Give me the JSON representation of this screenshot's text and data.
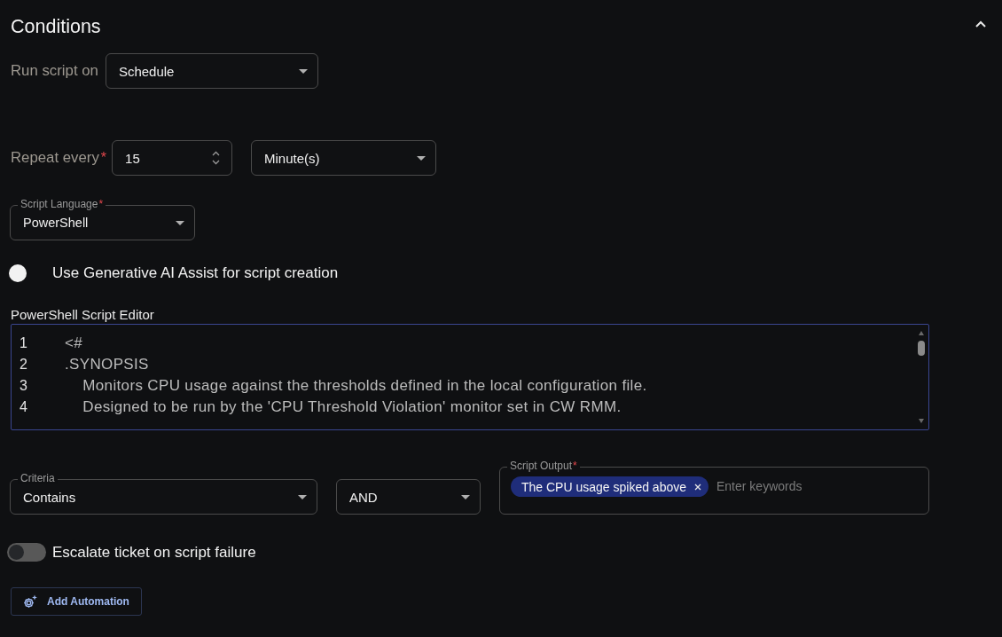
{
  "section": {
    "title": "Conditions",
    "expanded": true
  },
  "run_script_on": {
    "label": "Run script on",
    "value": "Schedule"
  },
  "repeat": {
    "label": "Repeat every",
    "required_mark": "*",
    "interval": "15",
    "unit": "Minute(s)"
  },
  "script_language": {
    "label": "Script Language",
    "required_mark": "*",
    "value": "PowerShell"
  },
  "ai_assist": {
    "label": "Use Generative AI Assist for script creation",
    "on": false
  },
  "editor": {
    "label": "PowerShell Script Editor",
    "lines": [
      {
        "number": "1",
        "code": "<#"
      },
      {
        "number": "2",
        "code": ".SYNOPSIS"
      },
      {
        "number": "3",
        "code": "    Monitors CPU usage against the thresholds defined in the local configuration file."
      },
      {
        "number": "4",
        "code": "    Designed to be run by the 'CPU Threshold Violation' monitor set in CW RMM."
      }
    ]
  },
  "criteria": {
    "label": "Criteria",
    "value": "Contains"
  },
  "operator": {
    "value": "AND"
  },
  "script_output": {
    "label": "Script Output",
    "required_mark": "*",
    "chips": [
      {
        "label": "The CPU usage spiked above"
      }
    ],
    "placeholder": "Enter keywords"
  },
  "escalate": {
    "label": "Escalate ticket on script failure",
    "on": false
  },
  "add_automation_button": {
    "label": "Add Automation"
  }
}
